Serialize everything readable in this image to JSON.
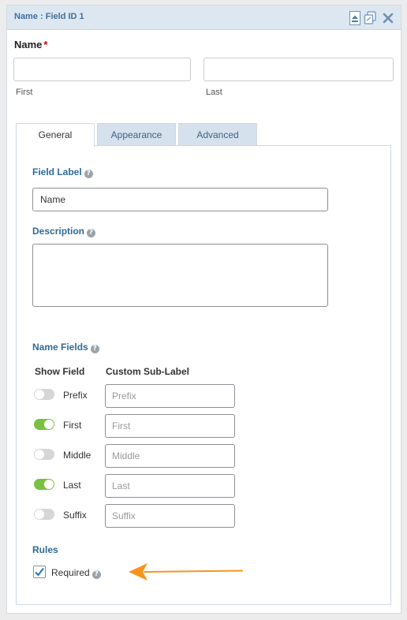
{
  "header": {
    "title": "Name : Field ID 1",
    "icons": [
      "collapse-icon",
      "duplicate-icon",
      "close-icon"
    ]
  },
  "preview": {
    "label": "Name",
    "required_mark": "*",
    "first_sublabel": "First",
    "last_sublabel": "Last"
  },
  "tabs": [
    {
      "label": "General",
      "active": true
    },
    {
      "label": "Appearance",
      "active": false
    },
    {
      "label": "Advanced",
      "active": false
    }
  ],
  "settings": {
    "field_label": {
      "title": "Field Label",
      "value": "Name"
    },
    "description": {
      "title": "Description",
      "value": ""
    },
    "name_fields": {
      "title": "Name Fields",
      "col_show": "Show Field",
      "col_sublabel": "Custom Sub-Label",
      "rows": [
        {
          "label": "Prefix",
          "enabled": false,
          "placeholder": "Prefix"
        },
        {
          "label": "First",
          "enabled": true,
          "placeholder": "First"
        },
        {
          "label": "Middle",
          "enabled": false,
          "placeholder": "Middle"
        },
        {
          "label": "Last",
          "enabled": true,
          "placeholder": "Last"
        },
        {
          "label": "Suffix",
          "enabled": false,
          "placeholder": "Suffix"
        }
      ]
    },
    "rules": {
      "title": "Rules",
      "required_label": "Required",
      "required_checked": true
    }
  },
  "colors": {
    "accent": "#2f6b96",
    "toggle_on": "#7ac143",
    "arrow": "#f7941d"
  }
}
